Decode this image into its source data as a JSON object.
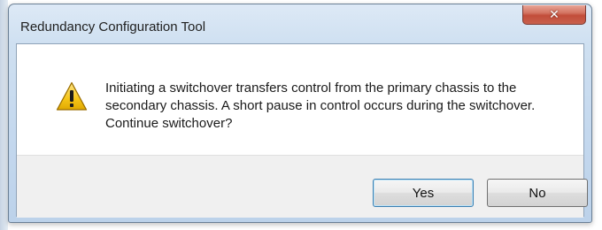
{
  "window": {
    "title": "Redundancy Configuration Tool",
    "close_icon": "close-icon"
  },
  "dialog": {
    "icon": "warning-icon",
    "message": "Initiating a switchover transfers control from the primary chassis to the secondary chassis. A short pause in control occurs during the switchover. Continue switchover?"
  },
  "buttons": {
    "yes_label": "Yes",
    "no_label": "No"
  },
  "colors": {
    "accent": "#3c7fb1",
    "close_red": "#c24d3a",
    "warning_yellow": "#f5c518"
  }
}
